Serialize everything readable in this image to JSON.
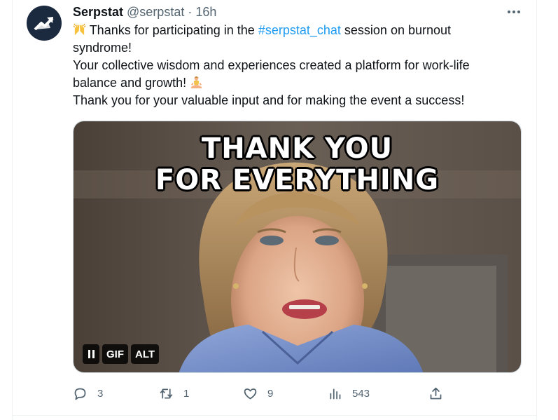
{
  "author": {
    "name": "Serpstat",
    "handle": "@serpstat",
    "separator": "·",
    "time": "16h"
  },
  "tweet": {
    "line1_pre": "Thanks for participating in the ",
    "hashtag": "#serpstat_chat",
    "line1_post": " session on burnout",
    "line2": "syndrome!",
    "line3": "Your collective wisdom and experiences created a platform for work-life",
    "line4_pre": "balance and growth! ",
    "line5": "Thank you for your valuable input and for making the event a success!"
  },
  "media": {
    "caption_line1": "THANK YOU",
    "caption_line2": "FOR EVERYTHING",
    "gif_label": "GIF",
    "alt_label": "ALT"
  },
  "actions": {
    "replies": "3",
    "retweets": "1",
    "likes": "9",
    "views": "543"
  },
  "icons": {
    "raised_hands": "raised-hands-emoji",
    "meditation": "person-in-lotus-position-emoji",
    "more": "more-icon",
    "reply": "reply-icon",
    "retweet": "retweet-icon",
    "like": "heart-icon",
    "views": "views-icon",
    "share": "share-icon"
  },
  "colors": {
    "link": "#1d9bf0",
    "secondary": "#536471",
    "text": "#0f1419",
    "avatar_bg": "#1b2a3f"
  }
}
